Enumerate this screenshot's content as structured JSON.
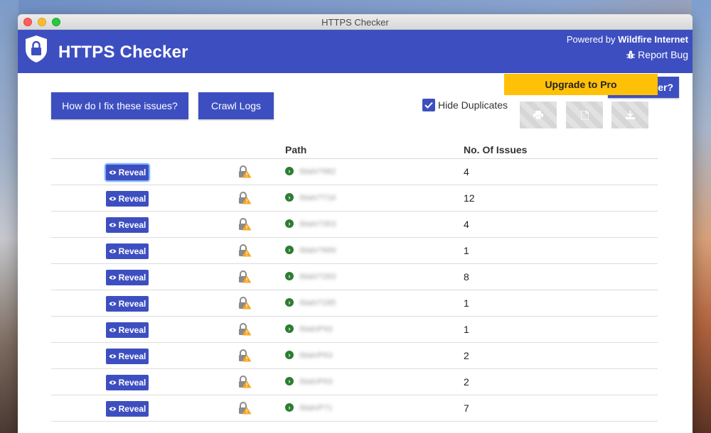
{
  "window": {
    "title": "HTTPS Checker"
  },
  "header": {
    "app_title": "HTTPS Checker",
    "powered_prefix": "Powered by",
    "powered_brand": "Wildfire Internet",
    "report_bug": "Report Bug"
  },
  "toolbar": {
    "fix_button": "How do I fix these issues?",
    "crawl_logs_button": "Crawl Logs",
    "partial_button": "er?",
    "upgrade_button": "Upgrade to Pro",
    "hide_duplicates_label": "Hide Duplicates",
    "hide_duplicates_checked": true,
    "actions": [
      "print-icon",
      "pdf-icon",
      "download-icon"
    ]
  },
  "table": {
    "columns": [
      "",
      "",
      "Path",
      "No. Of Issues"
    ],
    "reveal_label": "Reveal",
    "rows": [
      {
        "path": "/blah/?982",
        "issues": "4"
      },
      {
        "path": "/blah/?716",
        "issues": "12"
      },
      {
        "path": "/blah/?353",
        "issues": "4"
      },
      {
        "path": "/blah/?669",
        "issues": "1"
      },
      {
        "path": "/blah/?283",
        "issues": "8"
      },
      {
        "path": "/blah/?285",
        "issues": "1"
      },
      {
        "path": "/blah/P93",
        "issues": "1"
      },
      {
        "path": "/blah/P63",
        "issues": "2"
      },
      {
        "path": "/blah/P63",
        "issues": "2"
      },
      {
        "path": "/blah/P71",
        "issues": "7"
      }
    ]
  },
  "colors": {
    "primary": "#3d4fc0",
    "upgrade": "#ffc107",
    "arrow_green": "#2e7d32",
    "lock_warning": "#f5a623"
  }
}
